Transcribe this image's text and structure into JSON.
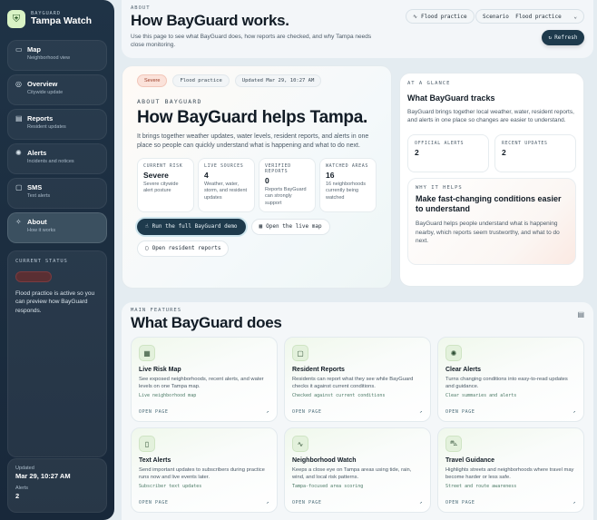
{
  "sidebar": {
    "brand_small": "BAYGUARD",
    "brand_name": "Tampa Watch",
    "items": [
      {
        "label": "Map",
        "sub": "Neighborhood view",
        "icon": "map-icon"
      },
      {
        "label": "Overview",
        "sub": "Citywide update",
        "icon": "compass-icon"
      },
      {
        "label": "Reports",
        "sub": "Resident updates",
        "icon": "document-icon"
      },
      {
        "label": "Alerts",
        "sub": "Incidents and notices",
        "icon": "bell-icon"
      },
      {
        "label": "SMS",
        "sub": "Text alerts",
        "icon": "message-icon"
      },
      {
        "label": "About",
        "sub": "How it works",
        "icon": "sparkle-icon"
      }
    ],
    "status": {
      "title": "CURRENT STATUS",
      "text": "Flood practice is active so you can preview how BayGuard responds."
    },
    "updated": {
      "updated_label": "Updated",
      "updated_value": "Mar 29, 10:27 AM",
      "alerts_label": "Alerts",
      "alerts_value": "2"
    }
  },
  "header": {
    "eyebrow": "ABOUT",
    "title": "How BayGuard works.",
    "desc": "Use this page to see what BayGuard does, how reports are checked, and why Tampa needs close monitoring.",
    "flood_chip": "Flood practice",
    "scenario_label": "Scenario",
    "scenario_value": "Flood practice",
    "refresh": "Refresh"
  },
  "hero": {
    "pills": [
      "Severe",
      "Flood practice",
      "Updated Mar 29, 10:27 AM"
    ],
    "eyebrow": "ABOUT BAYGUARD",
    "title": "How BayGuard helps Tampa.",
    "desc": "It brings together weather updates, water levels, resident reports, and alerts in one place so people can quickly understand what is happening and what to do next.",
    "stats": [
      {
        "label": "CURRENT RISK",
        "value": "Severe",
        "desc": "Severe citywide alert posture"
      },
      {
        "label": "LIVE SOURCES",
        "value": "4",
        "desc": "Weather, water, storm, and resident updates"
      },
      {
        "label": "VERIFIED REPORTS",
        "value": "0",
        "desc": "Reports BayGuard can strongly support"
      },
      {
        "label": "WATCHED AREAS",
        "value": "16",
        "desc": "16 neighborhoods currently being watched"
      }
    ],
    "actions": {
      "demo": "Run the full BayGuard demo",
      "map": "Open the live map",
      "reports": "Open resident reports"
    }
  },
  "glance": {
    "eyebrow": "AT A GLANCE",
    "title": "What BayGuard tracks",
    "desc": "BayGuard brings together local weather, water, resident reports, and alerts in one place so changes are easier to understand.",
    "official_label": "OFFICIAL ALERTS",
    "official_value": "2",
    "recent_label": "RECENT UPDATES",
    "recent_value": "2",
    "why_eyebrow": "WHY IT HELPS",
    "why_title": "Make fast-changing conditions easier to understand",
    "why_desc": "BayGuard helps people understand what is happening nearby, which reports seem trustworthy, and what to do next."
  },
  "features": {
    "eyebrow": "MAIN FEATURES",
    "title": "What BayGuard does",
    "open_label": "OPEN PAGE",
    "cards": [
      {
        "title": "Live Risk Map",
        "desc": "See exposed neighborhoods, recent alerts, and water levels on one Tampa map.",
        "tag": "Live neighborhood map",
        "icon": "map-icon"
      },
      {
        "title": "Resident Reports",
        "desc": "Residents can report what they see while BayGuard checks it against current conditions.",
        "tag": "Checked against current conditions",
        "icon": "chat-icon"
      },
      {
        "title": "Clear Alerts",
        "desc": "Turns changing conditions into easy-to-read updates and guidance.",
        "tag": "Clear summaries and alerts",
        "icon": "alert-icon"
      },
      {
        "title": "Text Alerts",
        "desc": "Send important updates to subscribers during practice runs now and live events later.",
        "tag": "Subscriber text updates",
        "icon": "phone-icon"
      },
      {
        "title": "Neighborhood Watch",
        "desc": "Keeps a close eye on Tampa areas using tide, rain, wind, and local risk patterns.",
        "tag": "Tampa-focused area scoring",
        "icon": "activity-icon"
      },
      {
        "title": "Travel Guidance",
        "desc": "Highlights streets and neighborhoods where travel may become harder or less safe.",
        "tag": "Street and route awareness",
        "icon": "car-icon"
      }
    ]
  }
}
